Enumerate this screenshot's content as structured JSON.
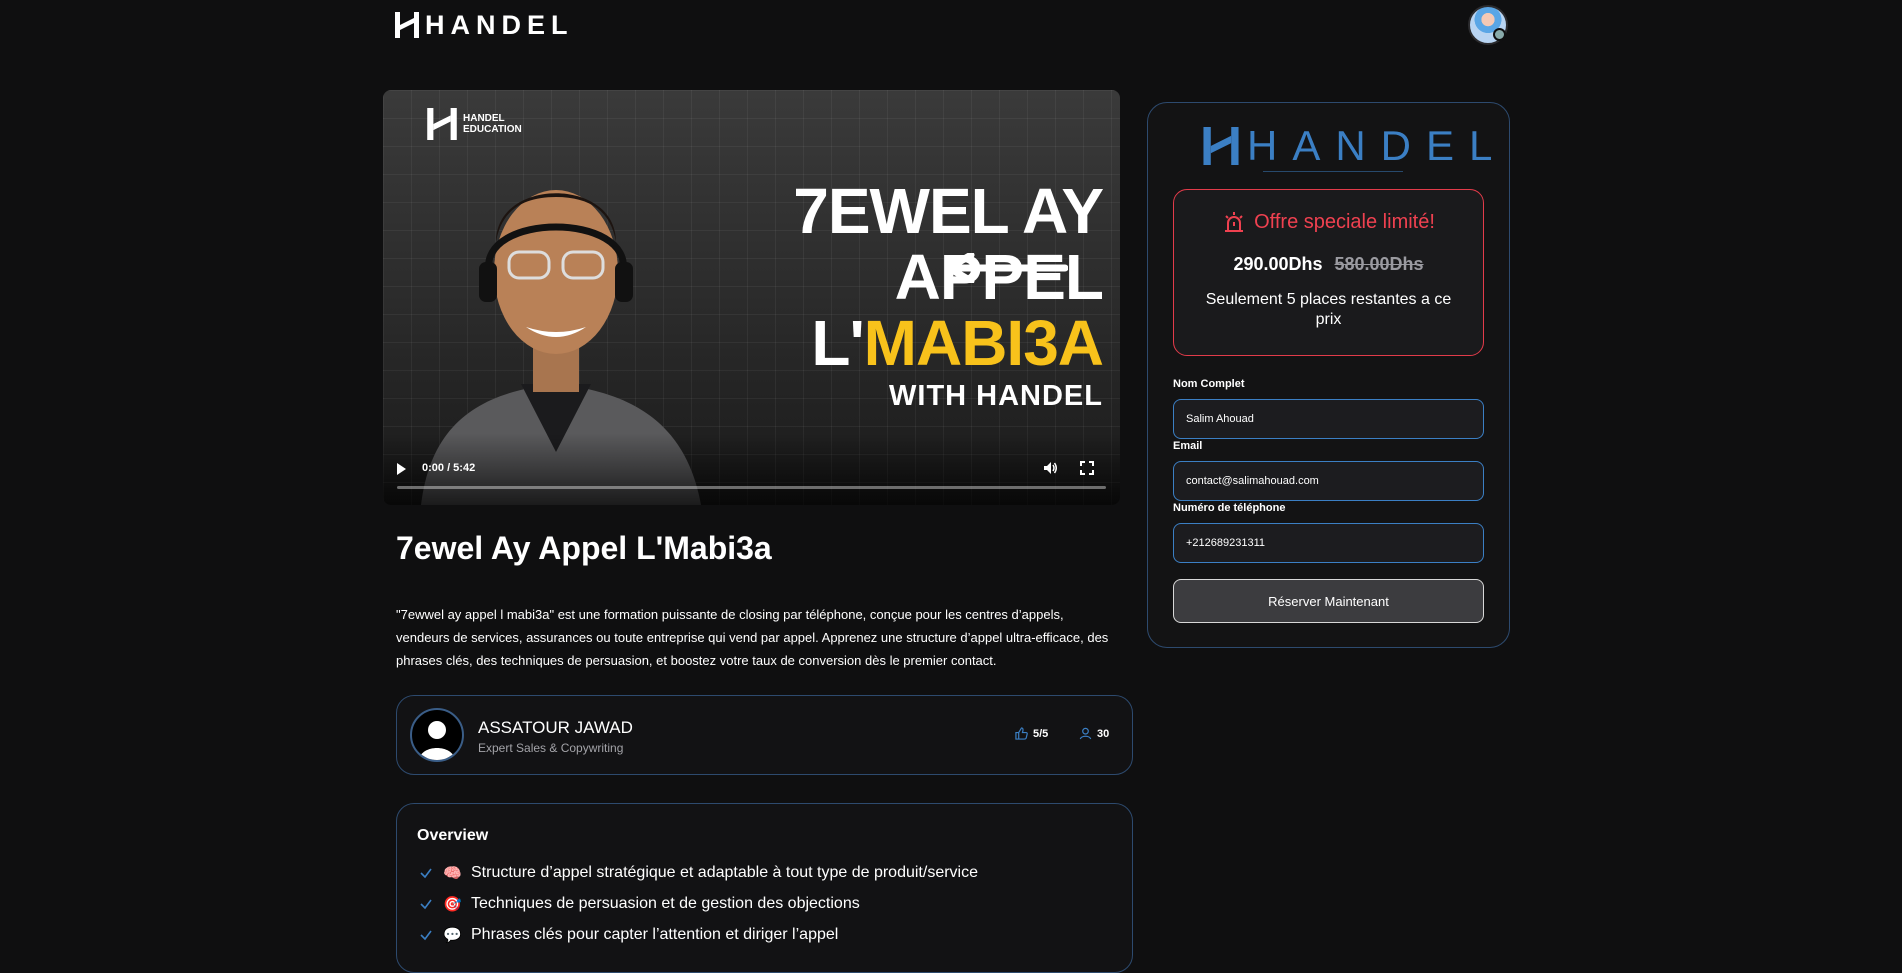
{
  "header": {
    "brand": "HANDEL",
    "avatar_alt": "user avatar"
  },
  "video": {
    "brand_line1": "HANDEL",
    "brand_line2": "EDUCATION",
    "headline_line1": "7EWEL AY",
    "headline_line2": "APPEL",
    "headline_line3_prefix": "L'",
    "headline_line3_highlight": "MABI3A",
    "headline_line4": "WITH HANDEL",
    "time": "0:00 / 5:42",
    "progress": 0,
    "highlight_color": "#f8c21b"
  },
  "course": {
    "title": "7ewel Ay Appel L'Mabi3a",
    "description": "\"7ewwel ay appel l mabi3a\" est une formation puissante de closing par téléphone, conçue pour les centres d’appels, vendeurs de services, assurances ou toute entreprise qui vend par appel. Apprenez une structure d’appel ultra-efficace, des phrases clés, des techniques de persuasion, et boostez votre taux de conversion dès le premier contact."
  },
  "instructor": {
    "name": "ASSATOUR JAWAD",
    "role": "Expert Sales & Copywriting",
    "rating": "5/5",
    "students": "30"
  },
  "overview": {
    "title": "Overview",
    "items": [
      {
        "emoji": "🧠",
        "text": "Structure d’appel stratégique et adaptable à tout type de produit/service"
      },
      {
        "emoji": "🎯",
        "text": "Techniques de persuasion et de gestion des objections"
      },
      {
        "emoji": "💬",
        "text": "Phrases clés pour capter l’attention et diriger l’appel"
      }
    ]
  },
  "offer_card": {
    "brand": "HANDEL",
    "offer_title": "Offre speciale limité!",
    "price": "290.00Dhs",
    "old_price": "580.00Dhs",
    "note": "Seulement 5 places restantes a ce prix",
    "name_label": "Nom Complet",
    "name_value": "Salim Ahouad",
    "email_label": "Email",
    "email_value": "contact@salimahouad.com",
    "phone_label": "Numéro de téléphone",
    "phone_value": "+212689231311",
    "submit_label": "Réserver Maintenant",
    "accent_color": "#3b7fc4",
    "alert_color": "#ef4150"
  }
}
